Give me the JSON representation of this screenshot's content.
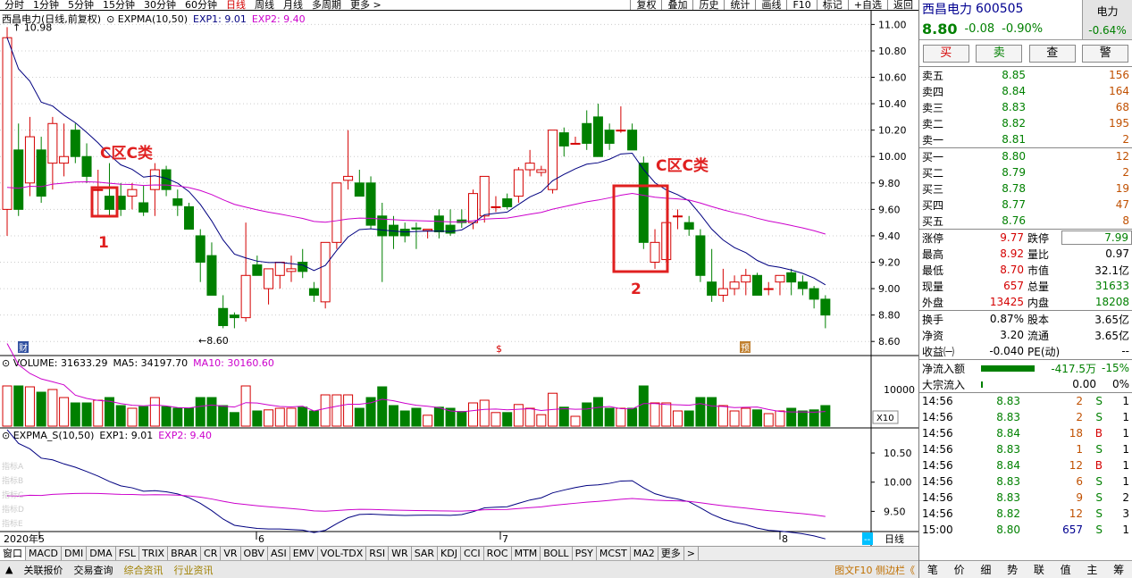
{
  "toolbar": {
    "periods": [
      {
        "label": "分时",
        "active": false
      },
      {
        "label": "1分钟",
        "active": false
      },
      {
        "label": "5分钟",
        "active": false
      },
      {
        "label": "15分钟",
        "active": false
      },
      {
        "label": "30分钟",
        "active": false
      },
      {
        "label": "60分钟",
        "active": false
      },
      {
        "label": "日线",
        "active": true
      },
      {
        "label": "周线",
        "active": false
      },
      {
        "label": "月线",
        "active": false
      },
      {
        "label": "多周期",
        "active": false
      },
      {
        "label": "更多 >",
        "active": false
      }
    ],
    "right_buttons": [
      "复权",
      "叠加",
      "历史",
      "统计",
      "画线",
      "F10",
      "标记",
      "+自选",
      "返回"
    ]
  },
  "chart": {
    "main_legend": {
      "name": "西昌电力(日线,前复权)",
      "indicator": "EXPMA(10,50)",
      "exp1": "EXP1: 9.01",
      "exp2": "EXP2: 9.40"
    },
    "high_label": "10.98",
    "low_label": "8.60",
    "y_ticks": [
      "11.00",
      "10.80",
      "10.60",
      "10.40",
      "10.20",
      "10.00",
      "9.80",
      "9.60",
      "9.40",
      "9.20",
      "9.00",
      "8.80",
      "8.60"
    ],
    "annotations": [
      {
        "text": "C区C类"
      },
      {
        "text": "1"
      },
      {
        "text": "C区C类"
      },
      {
        "text": "2"
      }
    ],
    "markers": {
      "cai": "财",
      "dollar": "$",
      "zhu": "预"
    },
    "volume_legend": {
      "name": "VOLUME: 31633.29",
      "ma5": "MA5: 34197.70",
      "ma10": "MA10: 30160.60"
    },
    "volume_ticks": {
      "top": "10000",
      "unit": "X10"
    },
    "sub_legend": {
      "name": "EXPMA_S(10,50)",
      "exp1": "EXP1: 9.01",
      "exp2": "EXP2: 9.40"
    },
    "sub_ticks": [
      "10.50",
      "10.00",
      "9.50"
    ],
    "sub_left_labels": [
      "指标A",
      "指标B",
      "指标C",
      "指标D",
      "指标E"
    ],
    "x_labels": [
      "2020年5",
      "6",
      "7",
      "8"
    ],
    "period_button": "日线",
    "zoom": [
      "+",
      "-"
    ]
  },
  "chart_data": {
    "type": "candlestick",
    "x_labels": [
      "2020年5",
      "6",
      "7",
      "8"
    ],
    "ylim": [
      8.5,
      11.05
    ],
    "ohlc": [
      [
        9.6,
        10.98,
        9.4,
        10.9
      ],
      [
        10.05,
        10.25,
        9.55,
        9.6
      ],
      [
        9.8,
        10.3,
        9.7,
        10.15
      ],
      [
        10.05,
        10.15,
        9.65,
        9.7
      ],
      [
        9.95,
        10.3,
        9.75,
        10.25
      ],
      [
        9.95,
        10.25,
        9.85,
        10.0
      ],
      [
        10.2,
        10.25,
        9.95,
        10.0
      ],
      [
        10.0,
        10.1,
        9.8,
        9.85
      ],
      [
        9.75,
        9.9,
        9.55,
        9.75
      ],
      [
        9.7,
        9.95,
        9.55,
        9.6
      ],
      [
        9.7,
        9.8,
        9.55,
        9.6
      ],
      [
        9.7,
        9.8,
        9.6,
        9.75
      ],
      [
        9.65,
        9.78,
        9.55,
        9.58
      ],
      [
        9.75,
        9.95,
        9.55,
        9.9
      ],
      [
        9.9,
        9.93,
        9.7,
        9.75
      ],
      [
        9.68,
        9.75,
        9.55,
        9.63
      ],
      [
        9.62,
        9.65,
        9.45,
        9.45
      ],
      [
        9.4,
        9.45,
        9.05,
        9.2
      ],
      [
        9.25,
        9.35,
        8.95,
        8.95
      ],
      [
        8.85,
        8.95,
        8.7,
        8.72
      ],
      [
        8.8,
        8.82,
        8.7,
        8.78
      ],
      [
        8.78,
        9.5,
        8.75,
        9.1
      ],
      [
        9.18,
        9.25,
        9.1,
        9.1
      ],
      [
        9.0,
        9.05,
        8.88,
        9.15
      ],
      [
        9.1,
        9.2,
        9.0,
        9.2
      ],
      [
        9.13,
        9.25,
        9.05,
        9.15
      ],
      [
        9.2,
        9.3,
        9.08,
        9.13
      ],
      [
        9.0,
        9.05,
        8.9,
        8.95
      ],
      [
        8.9,
        9.3,
        8.85,
        9.35
      ],
      [
        9.35,
        9.75,
        9.3,
        9.8
      ],
      [
        9.82,
        10.2,
        9.75,
        9.85
      ],
      [
        9.8,
        9.9,
        9.7,
        9.7
      ],
      [
        9.8,
        9.85,
        9.45,
        9.48
      ],
      [
        9.55,
        9.65,
        9.05,
        9.4
      ],
      [
        9.48,
        9.55,
        9.3,
        9.4
      ],
      [
        9.45,
        9.5,
        9.35,
        9.4
      ],
      [
        9.46,
        9.5,
        9.3,
        9.45
      ],
      [
        9.44,
        9.45,
        9.38,
        9.45
      ],
      [
        9.55,
        9.6,
        9.38,
        9.43
      ],
      [
        9.48,
        9.6,
        9.4,
        9.42
      ],
      [
        9.52,
        9.6,
        9.46,
        9.5
      ],
      [
        9.5,
        9.75,
        9.45,
        9.72
      ],
      [
        9.55,
        9.85,
        9.5,
        9.85
      ],
      [
        9.62,
        9.7,
        9.58,
        9.62
      ],
      [
        9.68,
        9.72,
        9.6,
        9.62
      ],
      [
        9.7,
        9.92,
        9.65,
        9.9
      ],
      [
        9.9,
        10.05,
        9.85,
        9.95
      ],
      [
        9.88,
        9.93,
        9.85,
        9.9
      ],
      [
        9.75,
        10.2,
        9.72,
        10.2
      ],
      [
        10.18,
        10.22,
        10.0,
        10.08
      ],
      [
        10.1,
        10.15,
        10.1,
        10.1
      ],
      [
        10.25,
        10.35,
        10.05,
        10.1
      ],
      [
        10.3,
        10.4,
        10.0,
        10.0
      ],
      [
        10.2,
        10.25,
        10.05,
        10.1
      ],
      [
        10.2,
        10.38,
        10.18,
        10.2
      ],
      [
        10.2,
        10.25,
        10.05,
        10.05
      ],
      [
        9.95,
        10.0,
        9.3,
        9.35
      ],
      [
        9.2,
        9.45,
        9.15,
        9.35
      ],
      [
        9.22,
        9.5,
        9.2,
        9.5
      ],
      [
        9.55,
        9.6,
        9.45,
        9.55
      ],
      [
        9.5,
        9.55,
        9.4,
        9.45
      ],
      [
        9.4,
        9.45,
        9.05,
        9.1
      ],
      [
        9.05,
        9.3,
        8.9,
        8.95
      ],
      [
        8.95,
        9.15,
        8.9,
        9.0
      ],
      [
        9.0,
        9.1,
        8.95,
        9.05
      ],
      [
        9.05,
        9.15,
        8.95,
        9.1
      ],
      [
        9.1,
        9.12,
        8.95,
        8.95
      ],
      [
        9.0,
        9.05,
        8.95,
        9.0
      ],
      [
        9.05,
        9.1,
        8.95,
        9.1
      ],
      [
        9.12,
        9.15,
        8.95,
        9.05
      ],
      [
        9.05,
        9.1,
        8.95,
        9.0
      ],
      [
        9.0,
        9.02,
        8.85,
        8.92
      ],
      [
        8.92,
        8.95,
        8.7,
        8.8
      ]
    ],
    "series": [
      {
        "name": "EXP1",
        "last": 9.01
      },
      {
        "name": "EXP2",
        "last": 9.4
      }
    ],
    "volume": {
      "last": 31633.29,
      "ma5": 34197.7,
      "ma10": 30160.6,
      "ylabel_tick": 10000
    },
    "expma_s": {
      "exp1": 9.01,
      "exp2": 9.4,
      "ticks": [
        10.5,
        10.0,
        9.5
      ]
    },
    "annotation_boxes": [
      {
        "label": "C区C类",
        "num": "1"
      },
      {
        "label": "C区C类",
        "num": "2"
      }
    ]
  },
  "quote": {
    "name": "西昌电力",
    "code": "600505",
    "sector": "电力",
    "price": "8.80",
    "change": "-0.08",
    "pct": "-0.90%",
    "sector_pct": "-0.64%",
    "actions": [
      "买",
      "卖",
      "查",
      "警"
    ],
    "asks": [
      {
        "label": "卖五",
        "price": "8.85",
        "vol": "156"
      },
      {
        "label": "卖四",
        "price": "8.84",
        "vol": "164"
      },
      {
        "label": "卖三",
        "price": "8.83",
        "vol": "68"
      },
      {
        "label": "卖二",
        "price": "8.82",
        "vol": "195"
      },
      {
        "label": "卖一",
        "price": "8.81",
        "vol": "2"
      }
    ],
    "bids": [
      {
        "label": "买一",
        "price": "8.80",
        "vol": "12"
      },
      {
        "label": "买二",
        "price": "8.79",
        "vol": "2"
      },
      {
        "label": "买三",
        "price": "8.78",
        "vol": "19"
      },
      {
        "label": "买四",
        "price": "8.77",
        "vol": "47"
      },
      {
        "label": "买五",
        "price": "8.76",
        "vol": "8"
      }
    ],
    "stats": [
      {
        "l1": "涨停",
        "v1": "9.77",
        "l2": "跌停",
        "v2": "7.99"
      },
      {
        "l1": "最高",
        "v1": "8.92",
        "l2": "量比",
        "v2": "0.97"
      },
      {
        "l1": "最低",
        "v1": "8.70",
        "l2": "市值",
        "v2": "32.1亿"
      },
      {
        "l1": "现量",
        "v1": "657",
        "l2": "总量",
        "v2": "31633"
      },
      {
        "l1": "外盘",
        "v1": "13425",
        "l2": "内盘",
        "v2": "18208"
      }
    ],
    "stats2": [
      {
        "l1": "换手",
        "v1": "0.87%",
        "l2": "股本",
        "v2": "3.65亿"
      },
      {
        "l1": "净资",
        "v1": "3.20",
        "l2": "流通",
        "v2": "3.65亿"
      },
      {
        "l1": "收益㈠",
        "v1": "-0.040",
        "l2": "PE(动)",
        "v2": "--"
      }
    ],
    "flow": [
      {
        "label": "净流入额",
        "value": "-417.5万",
        "pct": "-15%"
      },
      {
        "label": "大宗流入",
        "value": "0.00",
        "pct": "0%"
      }
    ],
    "ticks": [
      {
        "time": "14:56",
        "price": "8.83",
        "vol": "2",
        "side": "S",
        "n": "1"
      },
      {
        "time": "14:56",
        "price": "8.83",
        "vol": "2",
        "side": "S",
        "n": "1"
      },
      {
        "time": "14:56",
        "price": "8.84",
        "vol": "18",
        "side": "B",
        "n": "1"
      },
      {
        "time": "14:56",
        "price": "8.83",
        "vol": "1",
        "side": "S",
        "n": "1"
      },
      {
        "time": "14:56",
        "price": "8.84",
        "vol": "12",
        "side": "B",
        "n": "1"
      },
      {
        "time": "14:56",
        "price": "8.83",
        "vol": "6",
        "side": "S",
        "n": "1"
      },
      {
        "time": "14:56",
        "price": "8.83",
        "vol": "9",
        "side": "S",
        "n": "2"
      },
      {
        "time": "14:56",
        "price": "8.82",
        "vol": "12",
        "side": "S",
        "n": "3"
      },
      {
        "time": "15:00",
        "price": "8.80",
        "vol": "657",
        "side": "S",
        "n": "1"
      }
    ],
    "bottom_tabs": [
      "笔",
      "价",
      "细",
      "势",
      "联",
      "值",
      "主",
      "筹"
    ]
  },
  "indicator_tabs": [
    "窗口",
    "MACD",
    "DMI",
    "DMA",
    "FSL",
    "TRIX",
    "BRAR",
    "CR",
    "VR",
    "OBV",
    "ASI",
    "EMV",
    "VOL-TDX",
    "RSI",
    "WR",
    "SAR",
    "KDJ",
    "CCI",
    "ROC",
    "MTM",
    "BOLL",
    "PSY",
    "MCST",
    "MA2",
    "更多",
    ">"
  ],
  "status": {
    "items": [
      "关联报价",
      "交易查询",
      "综合资讯",
      "行业资讯"
    ],
    "right": "图文F10 侧边栏《"
  },
  "colors": {
    "up": "#d40000",
    "down": "#008000",
    "exp1": "#000080",
    "exp2": "#cc00cc"
  }
}
